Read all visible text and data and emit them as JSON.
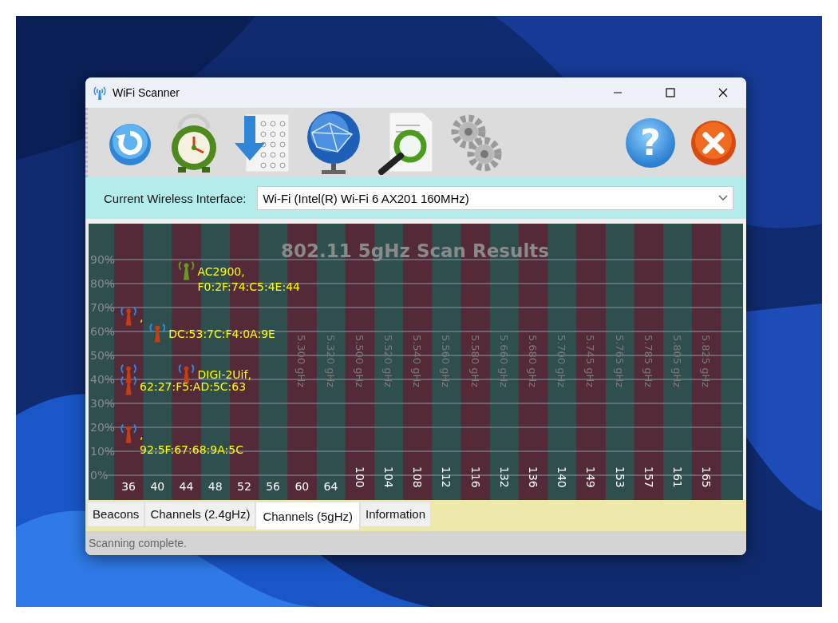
{
  "window": {
    "title": "WiFi Scanner"
  },
  "toolbar": [
    {
      "kind": "refresh"
    },
    {
      "kind": "clock"
    },
    {
      "kind": "download"
    },
    {
      "kind": "globe"
    },
    {
      "kind": "search"
    },
    {
      "kind": "settings"
    },
    {
      "kind": "help",
      "label": "?"
    },
    {
      "kind": "close"
    }
  ],
  "interface": {
    "label": "Current Wireless Interface:",
    "value": "Wi-Fi (Intel(R) Wi-Fi 6 AX201 160MHz)"
  },
  "chart": {
    "frequencies": [
      "5.300 gHz",
      "5.320 gHz",
      "5.500 gHz",
      "5.520 gHz",
      "5.540 gHz",
      "5.560 gHz",
      "5.580 gHz",
      "5.660 gHz",
      "5.680 gHz",
      "5.700 gHz",
      "5.745 gHz",
      "5.765 gHz",
      "5.785 gHz",
      "5.805 gHz",
      "5.825 gHz"
    ],
    "chart_data": {
      "type": "scatter",
      "title": "802.11 5gHz Scan Results",
      "grid": true,
      "ylim": [
        0,
        90
      ],
      "categories": [
        "36",
        "40",
        "44",
        "48",
        "52",
        "56",
        "60",
        "64",
        "100",
        "104",
        "108",
        "112",
        "116",
        "132",
        "136",
        "140",
        "149",
        "153",
        "157",
        "161",
        "165"
      ],
      "yticks": [
        {
          "value": 0,
          "label": "0%"
        },
        {
          "value": 10,
          "label": "10%"
        },
        {
          "value": 20,
          "label": "20%"
        },
        {
          "value": 30,
          "label": "30%"
        },
        {
          "value": 40,
          "label": "40%"
        },
        {
          "value": 50,
          "label": "50%"
        },
        {
          "value": 60,
          "label": "60%"
        },
        {
          "value": 70,
          "label": "70%"
        },
        {
          "value": 80,
          "label": "80%"
        },
        {
          "value": 90,
          "label": "90%"
        }
      ],
      "series": [
        {
          "color": "#c83c14",
          "values": [
            66,
            null,
            null,
            null,
            null,
            null,
            null,
            null,
            null,
            null,
            null,
            null,
            null,
            null,
            null,
            null,
            null,
            null,
            null,
            null,
            null
          ]
        },
        {
          "color": "#c83c14",
          "values": [
            null,
            59,
            null,
            null,
            null,
            null,
            null,
            null,
            null,
            null,
            null,
            null,
            null,
            null,
            null,
            null,
            null,
            null,
            null,
            null,
            null
          ]
        },
        {
          "color": "#6a9a1c",
          "values": [
            null,
            null,
            85,
            null,
            null,
            null,
            null,
            null,
            null,
            null,
            null,
            null,
            null,
            null,
            null,
            null,
            null,
            null,
            null,
            null,
            null
          ]
        },
        {
          "color": "#c83c14",
          "values": [
            42,
            null,
            null,
            null,
            null,
            null,
            null,
            null,
            null,
            null,
            null,
            null,
            null,
            null,
            null,
            null,
            null,
            null,
            null,
            null,
            null
          ]
        },
        {
          "color": "#c83c14",
          "values": [
            null,
            null,
            42,
            null,
            null,
            null,
            null,
            null,
            null,
            null,
            null,
            null,
            null,
            null,
            null,
            null,
            null,
            null,
            null,
            null,
            null
          ]
        },
        {
          "color": "#c83c14",
          "values": [
            37,
            null,
            null,
            null,
            null,
            null,
            null,
            null,
            null,
            null,
            null,
            null,
            null,
            null,
            null,
            null,
            null,
            null,
            null,
            null,
            null
          ]
        },
        {
          "color": "#c83c14",
          "values": [
            17,
            null,
            null,
            null,
            null,
            null,
            null,
            null,
            null,
            null,
            null,
            null,
            null,
            null,
            null,
            null,
            null,
            null,
            null,
            null,
            null
          ]
        }
      ],
      "annotations": [
        {
          "text": "AC2900,",
          "x": "44",
          "y": 85
        },
        {
          "text": "F0:2F:74:C5:4E:44",
          "x": "44",
          "y": 85
        },
        {
          "text": ",",
          "x": "36",
          "y": 66
        },
        {
          "text": "DC:53:7C:F4:0A:9E",
          "x": "40",
          "y": 59
        },
        {
          "text": "DIGI-2Uif,",
          "x": "44",
          "y": 42
        },
        {
          "text": "62:27:F5:AD:5C:63",
          "x": "36",
          "y": 37
        },
        {
          "text": ",",
          "x": "36",
          "y": 17
        },
        {
          "text": "92:5F:67:68:9A:5C",
          "x": "36",
          "y": 17
        }
      ]
    }
  },
  "tabs": [
    {
      "label": "Beacons",
      "selected": false
    },
    {
      "label": "Channels (2.4gHz)",
      "selected": false
    },
    {
      "label": "Channels (5gHz)",
      "selected": true
    },
    {
      "label": "Information",
      "selected": false
    }
  ],
  "status_bar": {
    "text": "Scanning complete."
  }
}
